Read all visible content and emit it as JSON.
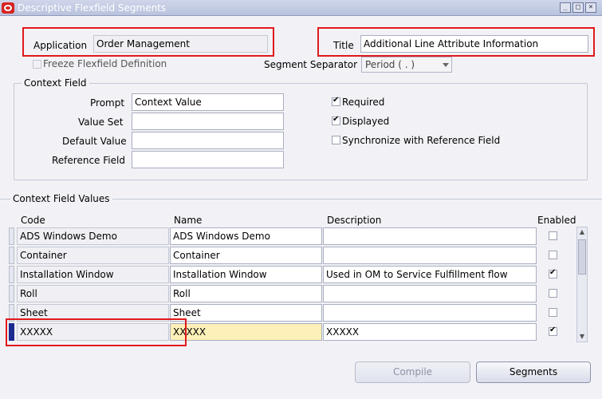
{
  "window": {
    "title": "Descriptive Flexfield Segments",
    "controls": [
      "_",
      "□",
      "×"
    ]
  },
  "header": {
    "application_label": "Application",
    "application_value": "Order Management",
    "title_label": "Title",
    "title_value": "Additional Line Attribute Information",
    "freeze_label": "Freeze Flexfield Definition",
    "separator_label": "Segment Separator",
    "separator_value": "Period ( . )"
  },
  "context_field": {
    "group_label": "Context Field",
    "prompt_label": "Prompt",
    "prompt_value": "Context Value",
    "value_set_label": "Value Set",
    "value_set_value": "",
    "default_value_label": "Default Value",
    "default_value_value": "",
    "reference_field_label": "Reference Field",
    "reference_field_value": "",
    "required_label": "Required",
    "required_checked": true,
    "displayed_label": "Displayed",
    "displayed_checked": true,
    "sync_label": "Synchronize with Reference Field",
    "sync_checked": false
  },
  "context_values": {
    "group_label": "Context Field Values",
    "columns": {
      "code": "Code",
      "name": "Name",
      "description": "Description",
      "enabled": "Enabled"
    },
    "rows": [
      {
        "code": "ADS Windows Demo",
        "name": "ADS Windows Demo",
        "description": "",
        "enabled": false
      },
      {
        "code": "Container",
        "name": "Container",
        "description": "",
        "enabled": false
      },
      {
        "code": "Installation Window",
        "name": "Installation Window",
        "description": "Used in OM to Service Fulfillment flow",
        "enabled": true
      },
      {
        "code": "Roll",
        "name": "Roll",
        "description": "",
        "enabled": false
      },
      {
        "code": "Sheet",
        "name": "Sheet",
        "description": "",
        "enabled": false
      },
      {
        "code": "XXXXX",
        "name": "XXXXX",
        "description": "XXXXX",
        "enabled": true
      }
    ]
  },
  "buttons": {
    "compile": "Compile",
    "segments": "Segments"
  },
  "colors": {
    "highlight": "#e0191c",
    "current_row_marker": "#1d2a8f",
    "active_cell": "#fdf0b8"
  }
}
